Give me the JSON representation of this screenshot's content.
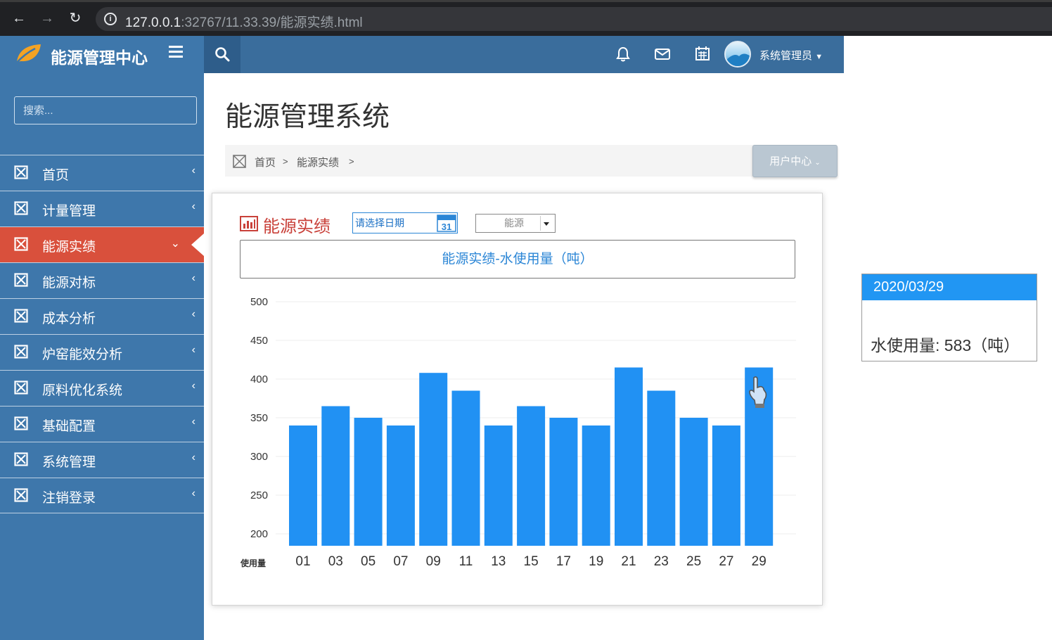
{
  "browser": {
    "url_host": "127.0.0.1",
    "url_rest": ":32767/11.33.39/能源实绩.html"
  },
  "header": {
    "app_title": "能源管理中心",
    "user_name": "系统管理员"
  },
  "sidebar": {
    "search_placeholder": "搜索...",
    "items": [
      {
        "label": "首页",
        "active": false
      },
      {
        "label": "计量管理",
        "active": false
      },
      {
        "label": "能源实绩",
        "active": true
      },
      {
        "label": "能源对标",
        "active": false
      },
      {
        "label": "成本分析",
        "active": false
      },
      {
        "label": "炉窑能效分析",
        "active": false
      },
      {
        "label": "原料优化系统",
        "active": false
      },
      {
        "label": "基础配置",
        "active": false
      },
      {
        "label": "系统管理",
        "active": false
      },
      {
        "label": "注销登录",
        "active": false
      }
    ]
  },
  "main": {
    "page_title": "能源管理系统",
    "breadcrumb": [
      "首页",
      "能源实绩"
    ],
    "breadcrumb_sep": ">",
    "user_center_label": "用户中心"
  },
  "panel": {
    "title": "能源实绩",
    "date_placeholder": "请选择日期",
    "calendar_day": "31",
    "energy_select_value": "能源",
    "chart_heading": "能源实绩-水使用量（吨）"
  },
  "chart_data": {
    "type": "bar",
    "title": "能源实绩-水使用量（吨）",
    "xlabel": "使用量",
    "ylabel": "",
    "categories": [
      "01",
      "03",
      "05",
      "07",
      "09",
      "11",
      "13",
      "15",
      "17",
      "19",
      "21",
      "23",
      "25",
      "27",
      "29"
    ],
    "values": [
      340,
      365,
      350,
      340,
      408,
      385,
      340,
      365,
      350,
      340,
      415,
      385,
      350,
      340,
      415
    ],
    "ylim": [
      200,
      500
    ],
    "yticks": [
      200,
      250,
      300,
      350,
      400,
      450,
      500
    ],
    "bar_color": "#2191f3",
    "grid": true
  },
  "tooltip": {
    "date": "2020/03/29",
    "text": "水使用量: 583（吨）"
  },
  "colors": {
    "sidebar_bg": "#3e77ab",
    "active_item": "#d9503c",
    "accent_blue": "#2196f3"
  }
}
